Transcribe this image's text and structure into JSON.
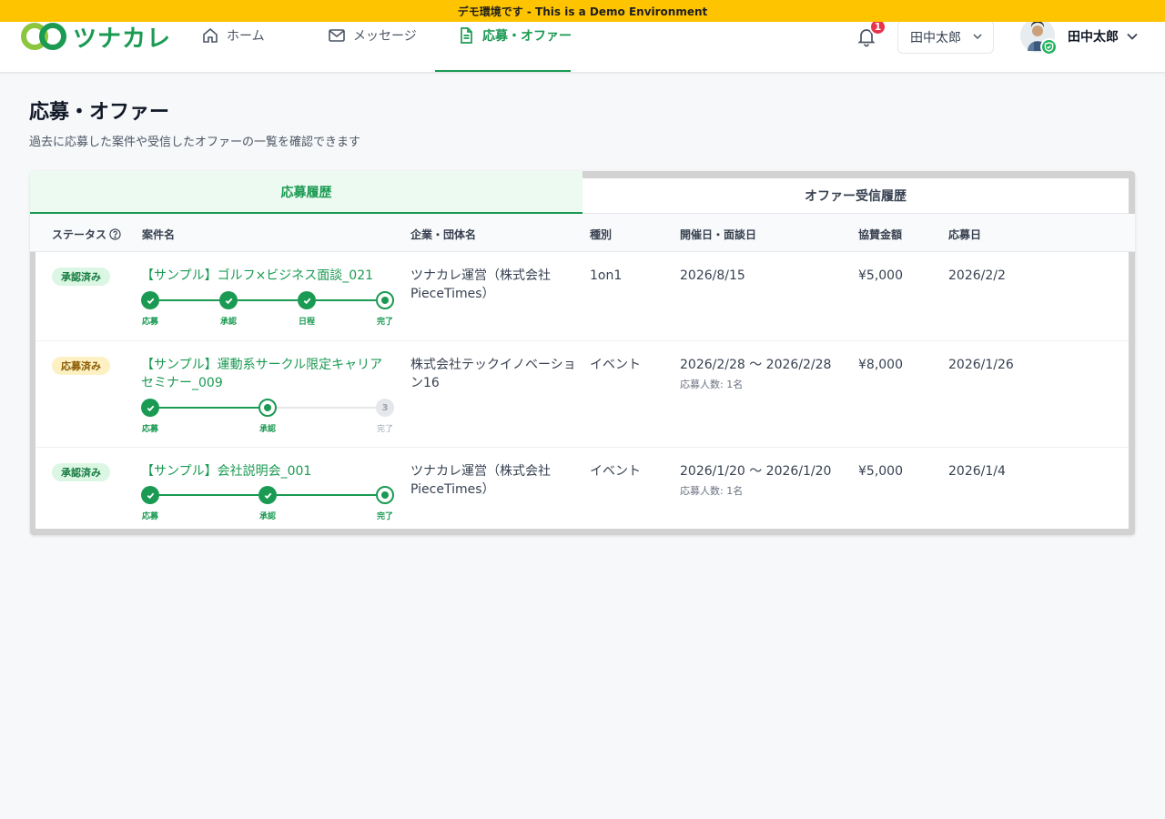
{
  "banner": "デモ環境です - This is a Demo Environment",
  "header": {
    "logo_text": "ツナカレ",
    "nav": [
      {
        "label": "ホーム",
        "icon": "home-icon"
      },
      {
        "label": "メッセージ",
        "icon": "mail-icon"
      },
      {
        "label": "応募・オファー",
        "icon": "document-icon"
      }
    ],
    "active_nav": "応募・オファー",
    "notification_count": "1",
    "account_select": "田中太郎",
    "user_name": "田中太郎"
  },
  "page": {
    "title": "応募・オファー",
    "subtitle": "過去に応募した案件や受信したオファーの一覧を確認できます"
  },
  "tabs": [
    {
      "label": "応募履歴",
      "active": true
    },
    {
      "label": "オファー受信履歴",
      "active": false
    }
  ],
  "columns": [
    "ステータス",
    "案件名",
    "企業・団体名",
    "種別",
    "開催日・面談日",
    "協賛金額",
    "応募日"
  ],
  "rows": [
    {
      "status": "承認済み",
      "status_type": "approved",
      "title": "【サンプル】ゴルフ×ビジネス面談_021",
      "company": "ツナカレ運営（株式会社PieceTimes）",
      "type": "1on1",
      "date": "2026/8/15",
      "date_note": "",
      "amount": "¥5,000",
      "applied": "2026/2/2",
      "steps": [
        {
          "label": "応募",
          "state": "done"
        },
        {
          "label": "承認",
          "state": "done"
        },
        {
          "label": "日程",
          "state": "done"
        },
        {
          "label": "完了",
          "state": "current"
        }
      ]
    },
    {
      "status": "応募済み",
      "status_type": "applied",
      "title": "【サンプル】運動系サークル限定キャリアセミナー_009",
      "company": "株式会社テックイノベーション16",
      "type": "イベント",
      "date": "2026/2/28 〜 2026/2/28",
      "date_note": "応募人数: 1名",
      "amount": "¥8,000",
      "applied": "2026/1/26",
      "steps": [
        {
          "label": "応募",
          "state": "done"
        },
        {
          "label": "承認",
          "state": "current"
        },
        {
          "label": "完了",
          "state": "todo",
          "number": "3"
        }
      ]
    },
    {
      "status": "承認済み",
      "status_type": "approved",
      "title": "【サンプル】会社説明会_001",
      "company": "ツナカレ運営（株式会社PieceTimes）",
      "type": "イベント",
      "date": "2026/1/20 〜 2026/1/20",
      "date_note": "応募人数: 1名",
      "amount": "¥5,000",
      "applied": "2026/1/4",
      "steps": [
        {
          "label": "応募",
          "state": "done"
        },
        {
          "label": "承認",
          "state": "done"
        },
        {
          "label": "完了",
          "state": "current"
        }
      ]
    }
  ],
  "colors": {
    "brand_green": "#1a9a52",
    "banner_yellow": "#ffc400",
    "badge_red": "#e8334a"
  }
}
